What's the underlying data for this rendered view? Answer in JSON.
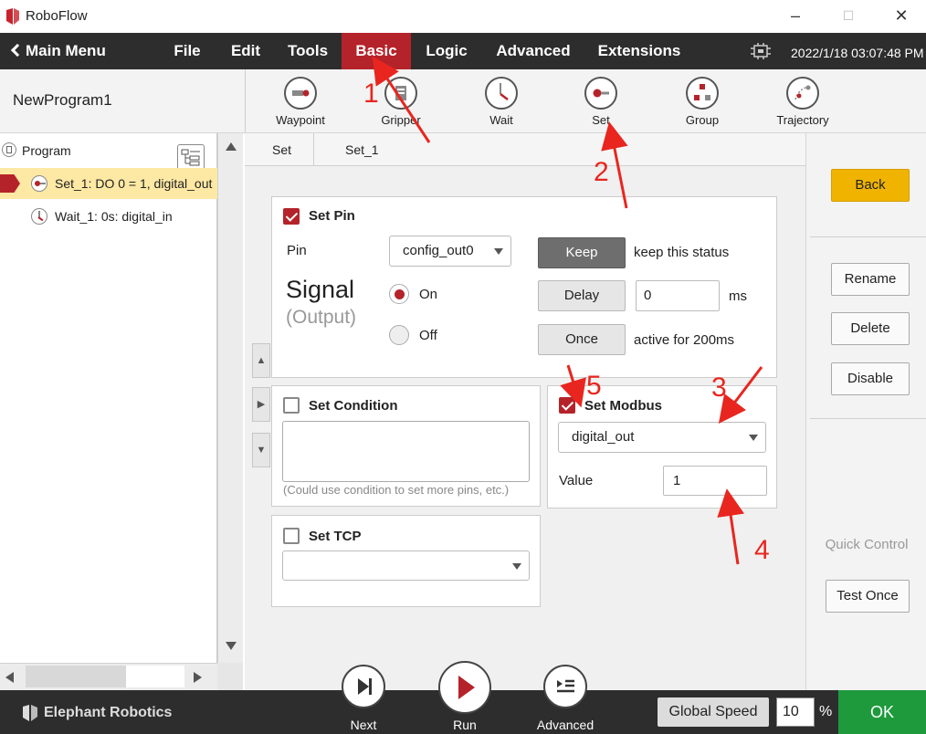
{
  "window": {
    "title": "RoboFlow",
    "minimize": "–",
    "maximize": "☐",
    "close": "✕"
  },
  "menubar": {
    "main_menu": "Main Menu",
    "items": [
      "File",
      "Edit",
      "Tools",
      "Basic",
      "Logic",
      "Advanced",
      "Extensions"
    ],
    "active": "Basic",
    "datetime": "2022/1/18 03:07:48 PM"
  },
  "program": {
    "name": "NewProgram1"
  },
  "toolbar": {
    "tools": [
      {
        "label": "Waypoint",
        "icon": "waypoint-icon"
      },
      {
        "label": "Gripper",
        "icon": "gripper-icon"
      },
      {
        "label": "Wait",
        "icon": "wait-icon"
      },
      {
        "label": "Set",
        "icon": "set-icon"
      },
      {
        "label": "Group",
        "icon": "group-icon"
      },
      {
        "label": "Trajectory",
        "icon": "trajectory-icon"
      }
    ]
  },
  "tree": {
    "root": "Program",
    "items": [
      {
        "label": "Set_1: DO 0 = 1, digital_out",
        "selected": true
      },
      {
        "label": "Wait_1: 0s: digital_in",
        "selected": false
      }
    ]
  },
  "tabs": [
    "Set",
    "Set_1"
  ],
  "set_pin": {
    "title": "Set Pin",
    "checked": true,
    "pin_label": "Pin",
    "pin_value": "config_out0",
    "signal_label": "Signal",
    "signal_sub": "(Output)",
    "on_label": "On",
    "off_label": "Off",
    "keep_label": "Keep",
    "keep_desc": "keep this status",
    "delay_label": "Delay",
    "delay_value": "0",
    "delay_unit": "ms",
    "once_label": "Once",
    "once_desc": "active for 200ms"
  },
  "set_condition": {
    "title": "Set Condition",
    "checked": false,
    "hint": "(Could use condition to set more pins, etc.)"
  },
  "set_tcp": {
    "title": "Set TCP",
    "checked": false,
    "value": ""
  },
  "set_modbus": {
    "title": "Set Modbus",
    "checked": true,
    "register": "digital_out",
    "value_label": "Value",
    "value": "1"
  },
  "right_panel": {
    "back": "Back",
    "rename": "Rename",
    "delete": "Delete",
    "disable": "Disable",
    "quick_control": "Quick Control",
    "test_once": "Test Once"
  },
  "bottom": {
    "brand": "Elephant Robotics",
    "next": "Next",
    "run": "Run",
    "advanced": "Advanced",
    "global_speed_label": "Global Speed",
    "global_speed_value": "10",
    "percent": "%",
    "ok": "OK"
  },
  "annotations": [
    "1",
    "2",
    "3",
    "4",
    "5"
  ],
  "colors": {
    "accent": "#b5232a",
    "back_button": "#f0b400",
    "ok_button": "#1e9a3c",
    "annotation": "#e8261f"
  }
}
